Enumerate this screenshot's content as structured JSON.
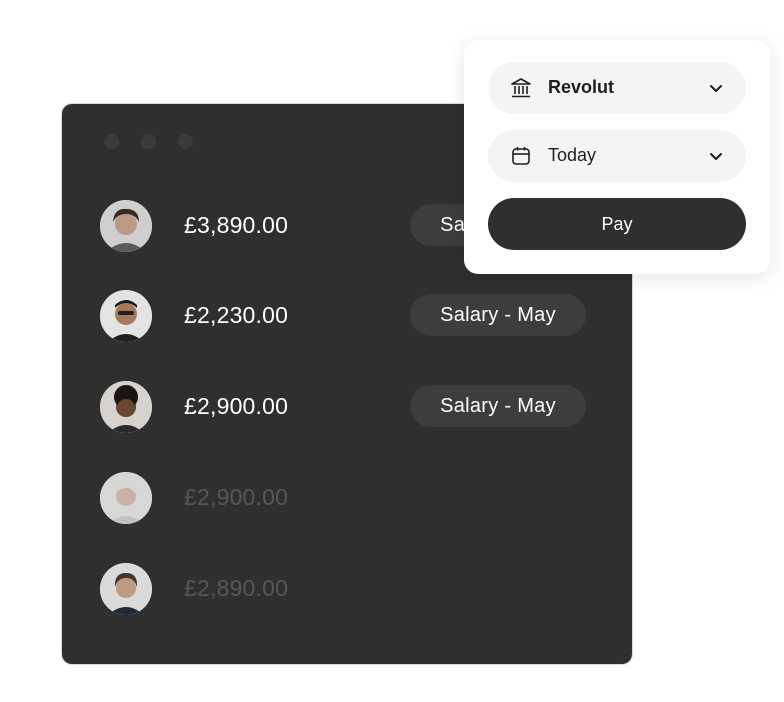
{
  "window": {
    "rows": [
      {
        "amount": "£3,890.00",
        "tag": "Salary - May",
        "muted": false
      },
      {
        "amount": "£2,230.00",
        "tag": "Salary - May",
        "muted": false
      },
      {
        "amount": "£2,900.00",
        "tag": "Salary - May",
        "muted": false
      },
      {
        "amount": "£2,900.00",
        "tag": "",
        "muted": true
      },
      {
        "amount": "£2,890.00",
        "tag": "",
        "muted": true
      }
    ]
  },
  "pay_card": {
    "account": {
      "label": "Revolut",
      "icon": "bank-icon"
    },
    "date": {
      "label": "Today",
      "icon": "calendar-icon"
    },
    "pay_label": "Pay"
  },
  "colors": {
    "window_bg": "#2f2f2f",
    "tag_bg": "#3d3d3d",
    "muted_text": "#575757",
    "pay_button": "#2f2f2f"
  }
}
